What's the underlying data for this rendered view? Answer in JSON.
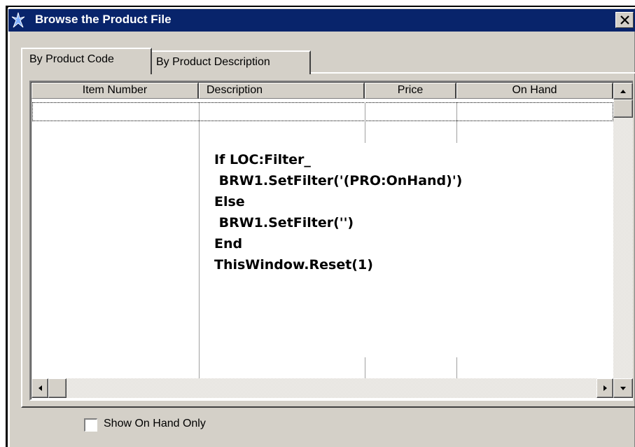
{
  "window": {
    "title": "Browse the Product File",
    "colors": {
      "titlebar": "#08246b",
      "face": "#d4d0c8",
      "title_text": "#ffffff"
    }
  },
  "tabs": [
    {
      "label": "By Product Code",
      "active": true
    },
    {
      "label": "By Product Description",
      "active": false
    }
  ],
  "list": {
    "columns": [
      "Item Number",
      "Description",
      "Price",
      "On Hand"
    ],
    "overlay_code": [
      "If LOC:Filter_",
      " BRW1.SetFilter('(PRO:OnHand)')",
      "Else",
      " BRW1.SetFilter('')",
      "End",
      "ThisWindow.Reset(1)"
    ]
  },
  "checkbox": {
    "label": "Show On Hand Only",
    "checked": false
  }
}
